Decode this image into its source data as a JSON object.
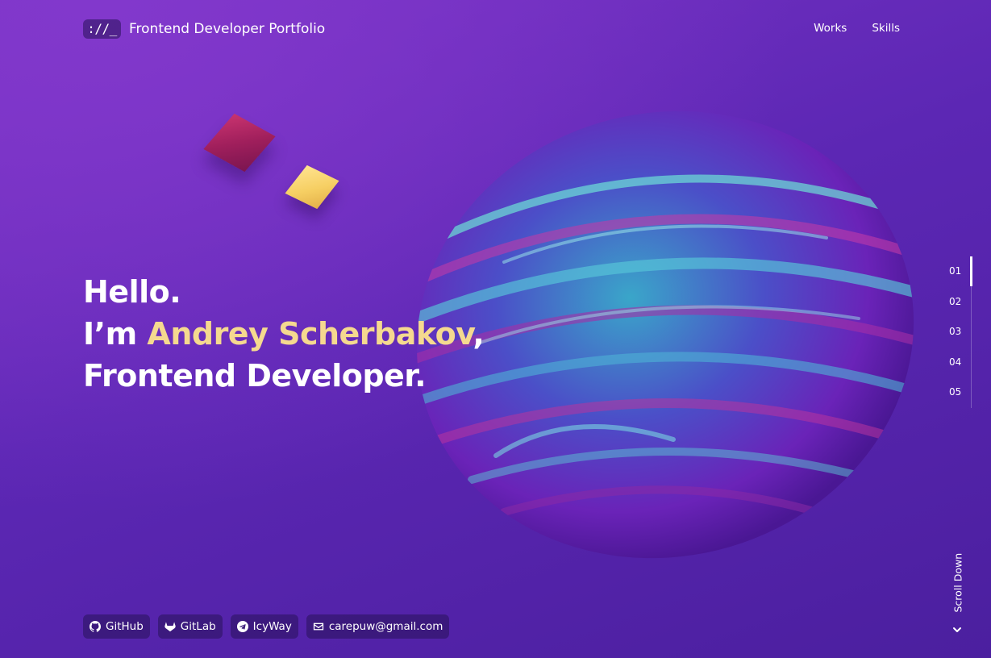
{
  "header": {
    "logo": "://_",
    "title": "Frontend Developer Portfolio",
    "nav": [
      "Works",
      "Skills"
    ]
  },
  "hero": {
    "line1": "Hello.",
    "line2_prefix": "I’m ",
    "name": "Andrey Scherbakov",
    "line2_suffix": ",",
    "line3": "Frontend Developer."
  },
  "sections": [
    "01",
    "02",
    "03",
    "04",
    "05"
  ],
  "active_section": "01",
  "links": [
    {
      "label": "GitHub",
      "icon": "github-icon"
    },
    {
      "label": "GitLab",
      "icon": "gitlab-icon"
    },
    {
      "label": "IcyWay",
      "icon": "telegram-icon"
    },
    {
      "label": "carepuw@gmail.com",
      "icon": "mail-icon"
    }
  ],
  "scroll": {
    "label": "Scroll Down"
  },
  "colors": {
    "background": "#5c27b4",
    "accent_name": "#f5d98f",
    "badge_bg": "#2c1460"
  }
}
